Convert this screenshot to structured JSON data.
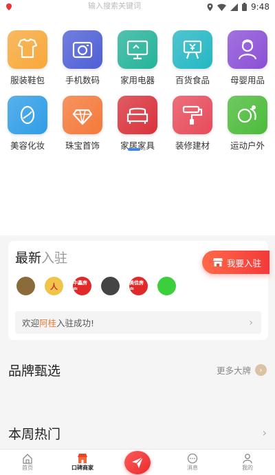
{
  "status_bar": {
    "time": "9:48",
    "search_ghost": "输入搜索关键词"
  },
  "categories": [
    {
      "label": "服装鞋包",
      "icon": "clothing-icon",
      "color": "#f7a83a"
    },
    {
      "label": "手机数码",
      "icon": "camera-icon",
      "color": "#4f5fd6"
    },
    {
      "label": "家用电器",
      "icon": "monitor-icon",
      "color": "#25b39a"
    },
    {
      "label": "百货食品",
      "icon": "grocery-icon",
      "color": "#24b7c3"
    },
    {
      "label": "母婴用品",
      "icon": "baby-icon",
      "color": "#8b4fd6"
    },
    {
      "label": "美容化妆",
      "icon": "cosmetics-icon",
      "color": "#2f9de6"
    },
    {
      "label": "珠宝首饰",
      "icon": "jewelry-icon",
      "color": "#f4793a"
    },
    {
      "label": "家居家具",
      "icon": "sofa-icon",
      "color": "#d9323c"
    },
    {
      "label": "装修建材",
      "icon": "paint-roller-icon",
      "color": "#e74b5a"
    },
    {
      "label": "运动户外",
      "icon": "sports-icon",
      "color": "#4cbb3a"
    }
  ],
  "new_join": {
    "title_main": "最新",
    "title_highlight": "入驻",
    "join_button": "我要入驻",
    "avatars": [
      {
        "text": "",
        "color": "#8b6b3a"
      },
      {
        "text": "人",
        "color": "#f0c34a"
      },
      {
        "text": "中鑫房产",
        "color": "#e02a2a"
      },
      {
        "text": "",
        "color": "#444444"
      },
      {
        "text": "美佳房产",
        "color": "#e02a2a"
      },
      {
        "text": "",
        "color": "#3ccf3c"
      }
    ],
    "welcome_prefix": "欢迎",
    "welcome_name": "阿桂",
    "welcome_suffix": "入驻成功!"
  },
  "brand_section": {
    "title": "品牌甄选",
    "more": "更多大牌"
  },
  "hot_section": {
    "title": "本周热门"
  },
  "tabbar": [
    {
      "label": "首页",
      "icon": "home-icon"
    },
    {
      "label": "口碑商家",
      "icon": "store-icon",
      "active": true
    },
    {
      "label": "",
      "icon": "send-icon"
    },
    {
      "label": "消息",
      "icon": "message-icon"
    },
    {
      "label": "我的",
      "icon": "user-icon"
    }
  ]
}
